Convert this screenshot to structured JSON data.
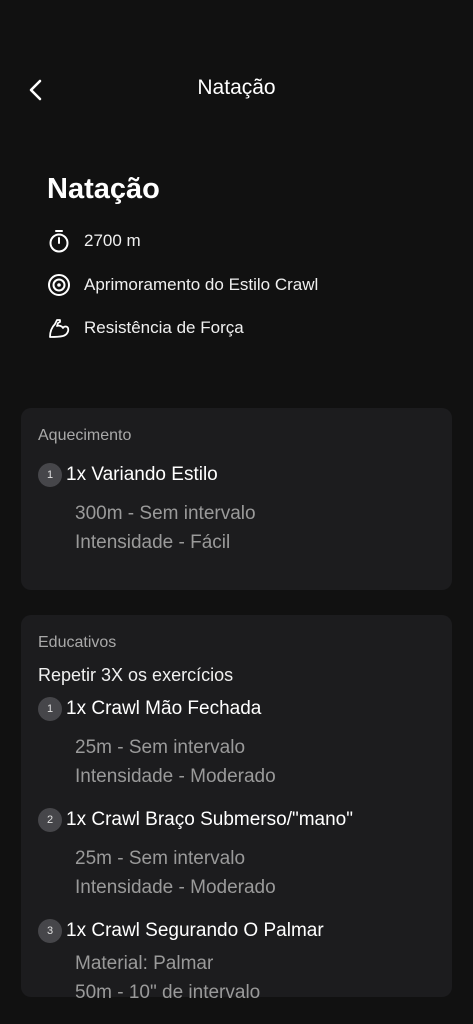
{
  "nav": {
    "title": "Natação"
  },
  "header": {
    "title": "Natação",
    "distance": "2700 m",
    "goal": "Aprimoramento do Estilo Crawl",
    "focus": "Resistência de Força"
  },
  "icons": {
    "back": "chevron-left-icon",
    "distance": "stopwatch-icon",
    "goal": "target-icon",
    "focus": "flexed-arm-icon"
  },
  "sections": [
    {
      "title": "Aquecimento",
      "exercises": [
        {
          "number": "1",
          "name": "1x Variando Estilo",
          "detail1": "300m - Sem intervalo",
          "detail2": "Intensidade - Fácil"
        }
      ]
    },
    {
      "title": "Educativos",
      "repeat": "Repetir 3X os exercícios",
      "exercises": [
        {
          "number": "1",
          "name": "1x Crawl Mão Fechada",
          "detail1": "25m - Sem intervalo",
          "detail2": "Intensidade - Moderado"
        },
        {
          "number": "2",
          "name": "1x Crawl Braço Submerso/\"mano\"",
          "detail1": "25m - Sem intervalo",
          "detail2": "Intensidade - Moderado"
        },
        {
          "number": "3",
          "name": "1x Crawl Segurando O Palmar",
          "detail1": "Material: Palmar",
          "detail2": "50m - 10\" de intervalo"
        }
      ]
    }
  ],
  "colors": {
    "background": "#111111",
    "card": "#1c1c1e",
    "badge": "#46464a",
    "secondary_text": "#9a9a9a"
  }
}
